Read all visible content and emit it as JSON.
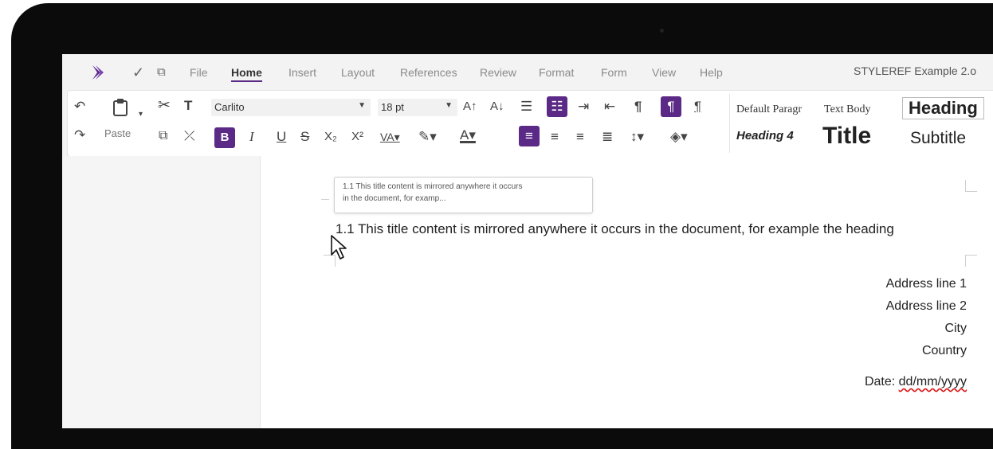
{
  "menu": {
    "items": [
      "File",
      "Home",
      "Insert",
      "Layout",
      "References",
      "Review",
      "Format",
      "Form",
      "View",
      "Help"
    ],
    "active": "Home",
    "document_title": "STYLEREF Example 2.o"
  },
  "toolbar": {
    "font": "Carlito",
    "size": "18 pt",
    "paste_label": "Paste",
    "colors": {
      "accent": "#5b2a86",
      "font_color_bar": "#000000"
    },
    "styles": [
      "Default Paragr",
      "Text Body",
      "Heading",
      "Heading 4",
      "Title",
      "Subtitle"
    ]
  },
  "document": {
    "tooltip_line1": "1.1 This title content is mirrored anywhere it occurs",
    "tooltip_line2": "in the document, for examp...",
    "heading": "1.1 This title content is mirrored anywhere it occurs in the document, for example the heading",
    "address": [
      "Address line 1",
      "Address line 2",
      "City",
      "Country"
    ],
    "date_label": "Date: ",
    "date_value": "dd/mm/yyyy"
  }
}
